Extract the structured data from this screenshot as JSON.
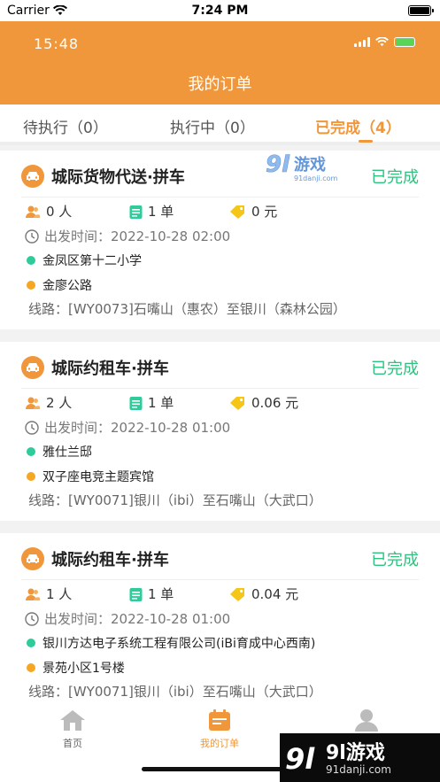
{
  "device": {
    "carrier": "Carrier",
    "time": "7:24 PM"
  },
  "header": {
    "app_time": "15:48",
    "title": "我的订单"
  },
  "tabs": [
    {
      "label": "待执行（0）"
    },
    {
      "label": "执行中（0）"
    },
    {
      "label": "已完成（4）",
      "active": true
    }
  ],
  "orders": [
    {
      "title": "城际货物代送·拼车",
      "status": "已完成",
      "people": "0 人",
      "count": "1 单",
      "price": "0 元",
      "departure": "出发时间：2022-10-28 02:00",
      "start": "金凤区第十二小学",
      "end": "金廖公路",
      "route": "线路：[WY0073]石嘴山（惠农）至银川（森林公园）"
    },
    {
      "title": "城际约租车·拼车",
      "status": "已完成",
      "people": "2 人",
      "count": "1 单",
      "price": "0.06 元",
      "departure": "出发时间：2022-10-28 01:00",
      "start": "雅仕兰邸",
      "end": "双子座电竞主题宾馆",
      "route": "线路：[WY0071]银川（ibi）至石嘴山（大武口）"
    },
    {
      "title": "城际约租车·拼车",
      "status": "已完成",
      "people": "1 人",
      "count": "1 单",
      "price": "0.04 元",
      "departure": "出发时间：2022-10-28 01:00",
      "start": "银川方达电子系统工程有限公司(iBi育成中心西南)",
      "end": "景苑小区1号楼",
      "route": "线路：[WY0071]银川（ibi）至石嘴山（大武口）"
    }
  ],
  "tabbar": [
    {
      "label": "首页",
      "icon": "home-icon"
    },
    {
      "label": "我的订单",
      "icon": "orders-icon",
      "active": true
    },
    {
      "label": "",
      "icon": "user-icon"
    }
  ],
  "watermark": {
    "logo": "9l游戏",
    "site": "91danji.com"
  },
  "colors": {
    "accent": "#f0973b",
    "status": "#2ec27e"
  }
}
